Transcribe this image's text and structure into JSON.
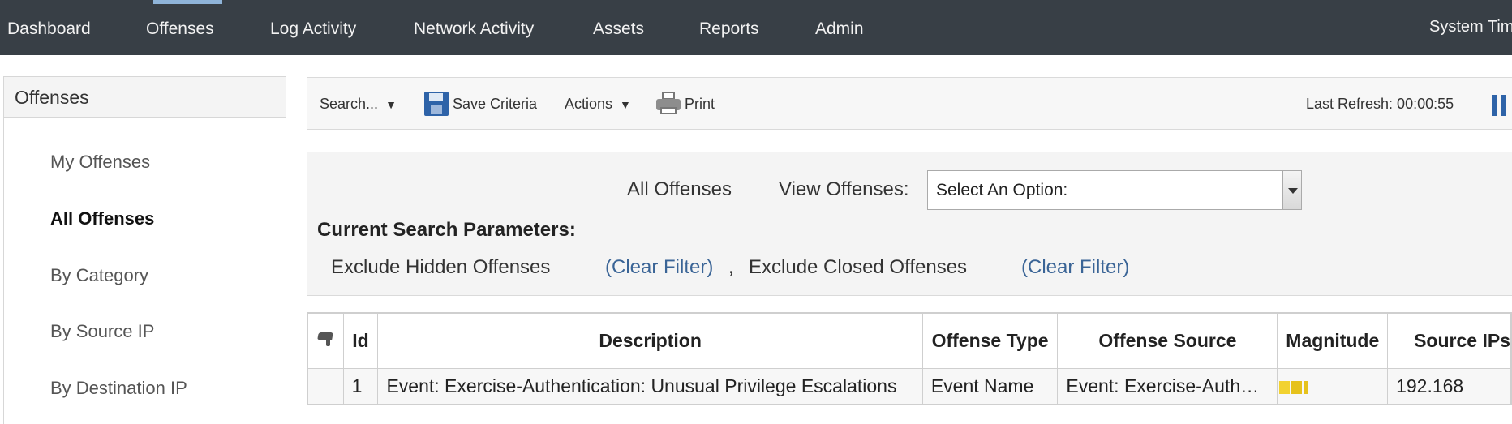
{
  "topnav": {
    "items": [
      "Dashboard",
      "Offenses",
      "Log Activity",
      "Network Activity",
      "Assets",
      "Reports",
      "Admin"
    ],
    "active": "Offenses",
    "right_text": "System Time"
  },
  "sidebar": {
    "title": "Offenses",
    "items": [
      "My Offenses",
      "All Offenses",
      "By Category",
      "By Source IP",
      "By Destination IP"
    ],
    "selected": "All Offenses"
  },
  "toolbar": {
    "search_label": "Search...",
    "save_label": "Save Criteria",
    "actions_label": "Actions",
    "print_label": "Print",
    "last_refresh": "Last Refresh: 00:00:55",
    "dropdown_arrow": "▼"
  },
  "params": {
    "title": "All Offenses",
    "view_label": "View Offenses:",
    "view_select_value": "Select An Option:",
    "current_label": "Current Search Parameters:",
    "filter1": "Exclude Hidden Offenses",
    "filter2": "Exclude Closed Offenses",
    "clear_filter": "(Clear Filter)",
    "separator": ","
  },
  "table": {
    "columns": [
      "",
      "Id",
      "Description",
      "Offense Type",
      "Offense Source",
      "Magnitude",
      "Source IPs"
    ],
    "rows": [
      {
        "flag": "",
        "id": "1",
        "description": "Event: Exercise-Authentication: Unusual Privilege Escalations",
        "offense_type": "Event Name",
        "offense_source": "Event: Exercise-Auth…",
        "magnitude": 2,
        "source_ip": "192.168"
      }
    ]
  },
  "colors": {
    "nav_bg": "#383f46",
    "active_indicator": "#8fb4d9",
    "link": "#3a6496",
    "accent_blue": "#2e63a8",
    "magnitude": "#f2d230"
  }
}
